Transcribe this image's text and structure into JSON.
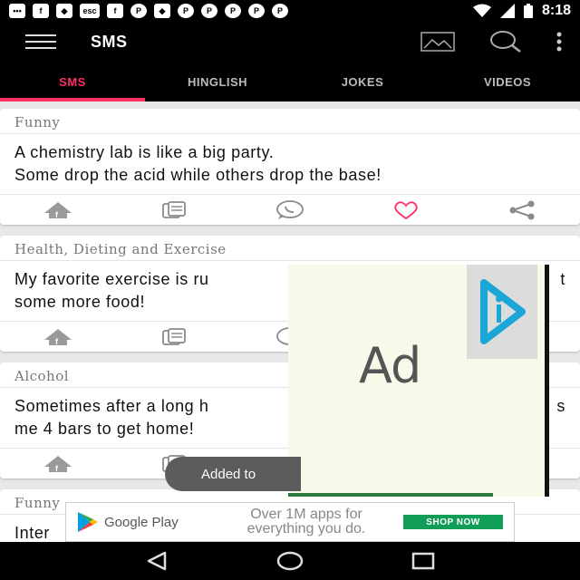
{
  "status_bar": {
    "notification_icons": [
      "message-icon",
      "facebook-icon",
      "cat-icon",
      "esc-icon",
      "facebook-icon",
      "pinterest-icon",
      "cat-icon",
      "pinterest-icon",
      "pinterest-icon",
      "pinterest-icon",
      "pinterest-icon",
      "pinterest-icon"
    ],
    "time": "8:18"
  },
  "app_bar": {
    "title": "SMS"
  },
  "tabs": [
    {
      "label": "SMS",
      "active": true
    },
    {
      "label": "HINGLISH",
      "active": false
    },
    {
      "label": "JOKES",
      "active": false
    },
    {
      "label": "VIDEOS",
      "active": false
    }
  ],
  "cards": [
    {
      "category": "Funny",
      "text": "A chemistry lab is like a big party.\nSome drop the acid while others drop the base!"
    },
    {
      "category": "Health, Dieting and Exercise",
      "text": "My favorite exercise is ru",
      "text_line2": "some more food!",
      "text_right": "t"
    },
    {
      "category": "Alcohol",
      "text": "Sometimes after a long h",
      "text_line2": "me 4 bars to get home!",
      "text_right": "s"
    },
    {
      "category": "Funny",
      "text": "Inter"
    }
  ],
  "ad_overlay": {
    "label": "Ad"
  },
  "toast": {
    "text": "Added to"
  },
  "play_banner": {
    "brand": "Google Play",
    "tagline_line1": "Over 1M apps for",
    "tagline_line2": "everything you do.",
    "cta": "SHOP NOW"
  },
  "colors": {
    "accent": "#ff2e63",
    "heart": "#ff2e63",
    "icon_gray": "#8a8a8a"
  }
}
